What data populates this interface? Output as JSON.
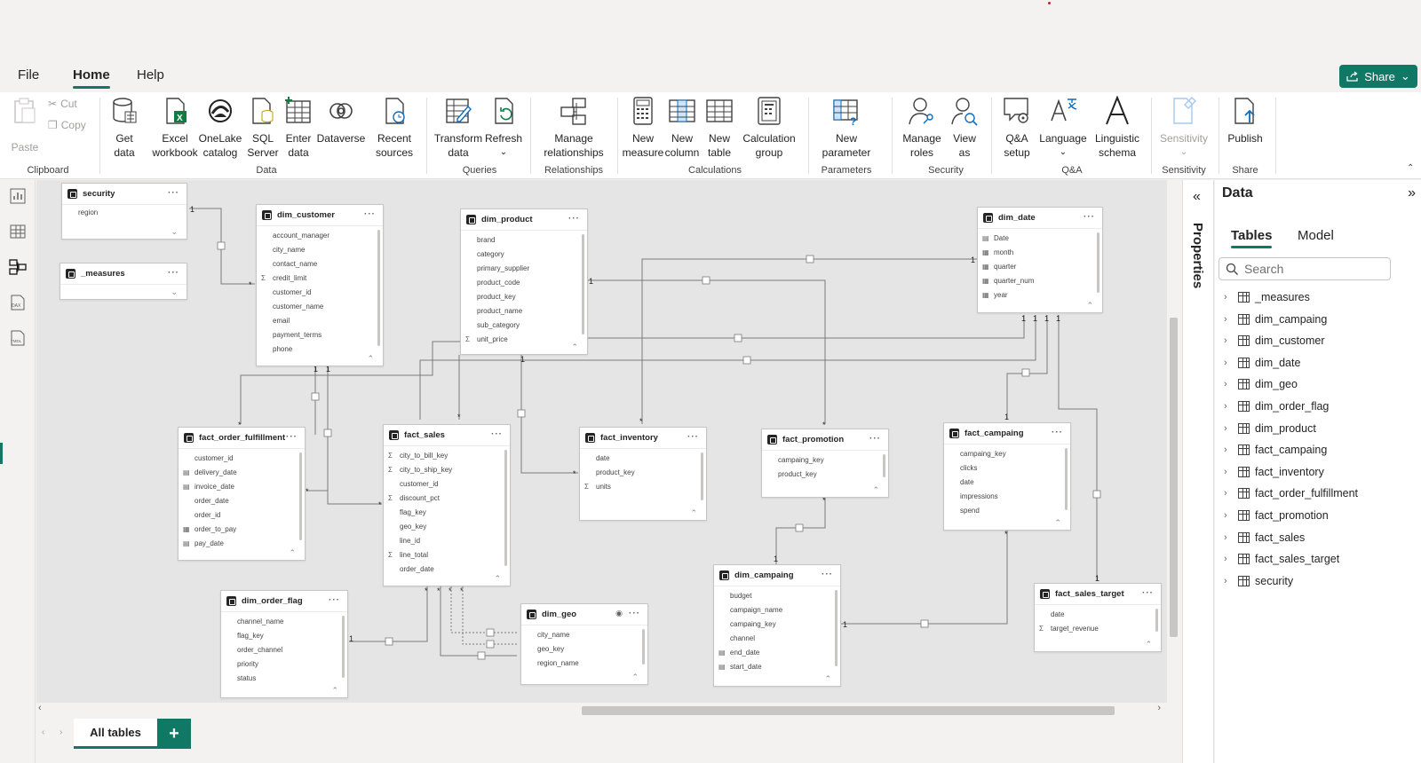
{
  "menu": {
    "tabs": [
      "File",
      "Home",
      "Help"
    ],
    "active": "Home",
    "share": "Share"
  },
  "ribbon": {
    "clipboard": {
      "paste": "Paste",
      "cut": "Cut",
      "copy": "Copy",
      "group": "Clipboard"
    },
    "data": {
      "get_data": "Get\ndata",
      "excel": "Excel\nworkbook",
      "onelake": "OneLake\ncatalog",
      "sql": "SQL\nServer",
      "enter": "Enter\ndata",
      "dataverse": "Dataverse",
      "recent": "Recent\nsources",
      "group": "Data"
    },
    "queries": {
      "transform": "Transform\ndata",
      "refresh": "Refresh",
      "group": "Queries"
    },
    "relationships": {
      "manage": "Manage\nrelationships",
      "group": "Relationships"
    },
    "calculations": {
      "measure": "New\nmeasure",
      "column": "New\ncolumn",
      "table": "New\ntable",
      "calcgroup": "Calculation\ngroup",
      "group": "Calculations"
    },
    "parameters": {
      "new": "New\nparameter",
      "group": "Parameters"
    },
    "security": {
      "roles": "Manage\nroles",
      "view_as": "View\nas",
      "group": "Security"
    },
    "qa": {
      "setup": "Q&A\nsetup",
      "language": "Language",
      "schema": "Linguistic\nschema",
      "group": "Q&A"
    },
    "sensitivity": {
      "label": "Sensitivity",
      "group": "Sensitivity"
    },
    "share": {
      "publish": "Publish",
      "group": "Share"
    }
  },
  "tables": {
    "security": {
      "name": "security",
      "fields": [
        "region"
      ]
    },
    "measures": {
      "name": "_measures",
      "fields": []
    },
    "dim_customer": {
      "name": "dim_customer",
      "fields": [
        "account_manager",
        "city_name",
        "contact_name",
        "credit_limit",
        "customer_id",
        "customer_name",
        "email",
        "payment_terms",
        "phone"
      ]
    },
    "dim_product": {
      "name": "dim_product",
      "fields": [
        "brand",
        "category",
        "primary_supplier",
        "product_code",
        "product_key",
        "product_name",
        "sub_category",
        "unit_price"
      ]
    },
    "dim_date": {
      "name": "dim_date",
      "fields": [
        "Date",
        "month",
        "quarter",
        "quarter_num",
        "year"
      ]
    },
    "fact_order_fulfillment": {
      "name": "fact_order_fulfillment",
      "fields": [
        "customer_id",
        "delivery_date",
        "invoice_date",
        "order_date",
        "order_id",
        "order_to_pay",
        "pay_date"
      ]
    },
    "fact_sales": {
      "name": "fact_sales",
      "fields": [
        "city_to_bill_key",
        "city_to_ship_key",
        "customer_id",
        "discount_pct",
        "flag_key",
        "geo_key",
        "line_id",
        "line_total",
        "order_date"
      ]
    },
    "fact_inventory": {
      "name": "fact_inventory",
      "fields": [
        "date",
        "product_key",
        "units"
      ]
    },
    "fact_promotion": {
      "name": "fact_promotion",
      "fields": [
        "campaing_key",
        "product_key"
      ]
    },
    "fact_campaing": {
      "name": "fact_campaing",
      "fields": [
        "campaing_key",
        "clicks",
        "date",
        "impressions",
        "spend"
      ]
    },
    "dim_order_flag": {
      "name": "dim_order_flag",
      "fields": [
        "channel_name",
        "flag_key",
        "order_channel",
        "priority",
        "status"
      ]
    },
    "dim_geo": {
      "name": "dim_geo",
      "fields": [
        "city_name",
        "geo_key",
        "region_name"
      ]
    },
    "dim_campaing": {
      "name": "dim_campaing",
      "fields": [
        "budget",
        "campaign_name",
        "campaing_key",
        "channel",
        "end_date",
        "start_date"
      ]
    },
    "fact_sales_target": {
      "name": "fact_sales_target",
      "fields": [
        "date",
        "target_revenue"
      ]
    }
  },
  "bottom": {
    "page_tab": "All tables",
    "add": "+"
  },
  "properties": {
    "label": "Properties"
  },
  "datapane": {
    "title": "Data",
    "tabs": [
      "Tables",
      "Model"
    ],
    "search_placeholder": "Search",
    "items": [
      "_measures",
      "dim_campaing",
      "dim_customer",
      "dim_date",
      "dim_geo",
      "dim_order_flag",
      "dim_product",
      "fact_campaing",
      "fact_inventory",
      "fact_order_fulfillment",
      "fact_promotion",
      "fact_sales",
      "fact_sales_target",
      "security"
    ]
  }
}
